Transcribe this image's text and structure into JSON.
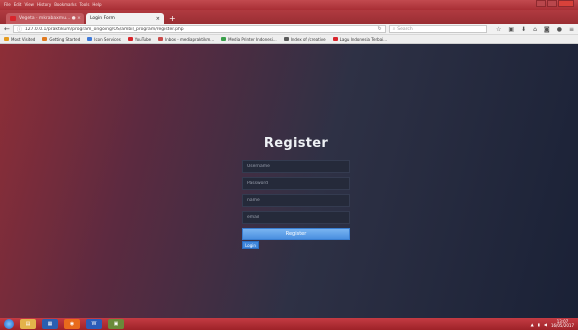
{
  "window": {
    "menu": [
      "File",
      "Edit",
      "View",
      "History",
      "Bookmarks",
      "Tools",
      "Help"
    ]
  },
  "tabs": [
    {
      "label": "Vegeta · mkrabaxmu... ● ×",
      "active": false
    },
    {
      "label": "Login Form",
      "active": true
    }
  ],
  "navbar": {
    "url": "127.0.0.1/praktikum/program_ongoing/OS/ambil_program/register.php",
    "search_placeholder": "Search"
  },
  "bookmarks": [
    {
      "label": "Most Visited",
      "color": "#e59b1f"
    },
    {
      "label": "Getting Started",
      "color": "#e0791f"
    },
    {
      "label": "Icon Services",
      "color": "#3f7ad8"
    },
    {
      "label": "YouTube",
      "color": "#d8252c"
    },
    {
      "label": "Inbox - mediapraktikm...",
      "color": "#c94c4c"
    },
    {
      "label": "Media Printer Indonesi...",
      "color": "#3a9f4a"
    },
    {
      "label": "Index of /creative",
      "color": "#5a5a5a"
    },
    {
      "label": "Lagu Indonesia Terbai...",
      "color": "#d8252c"
    }
  ],
  "form": {
    "title": "Register",
    "username_placeholder": "Username",
    "password_placeholder": "Password",
    "name_placeholder": "name",
    "email_placeholder": "email",
    "register_label": "Register",
    "login_label": "Login"
  },
  "taskbar": {
    "time": "13:07",
    "date": "16/05/2017"
  },
  "colors": {
    "accent_blue": "#4a8fe0",
    "titlebar": "#a82f35"
  }
}
